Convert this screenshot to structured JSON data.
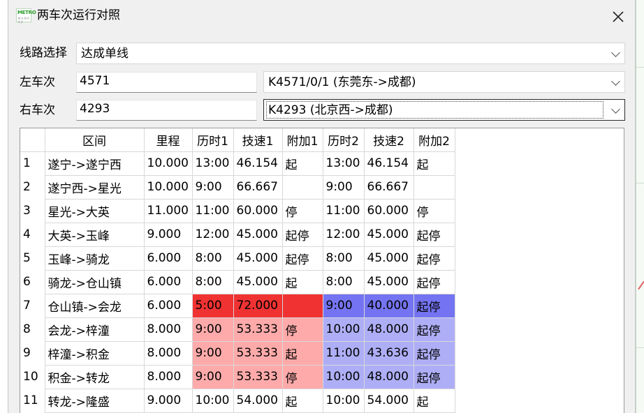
{
  "window": {
    "title": "两车次运行对照",
    "icon_text": "METRO",
    "icon_sub": "M A N A G E"
  },
  "form": {
    "line_label": "线路选择",
    "line_value": "达成单线",
    "left_label": "左车次",
    "left_value": "4571",
    "left_combo": "K4571/0/1 (东莞东->成都)",
    "right_label": "右车次",
    "right_value": "4293",
    "right_combo": "K4293 (北京西->成都)"
  },
  "table": {
    "headers": [
      "区间",
      "里程",
      "历时1",
      "技速1",
      "附加1",
      "历时2",
      "技速2",
      "附加2"
    ],
    "rows": [
      [
        "1",
        "遂宁->遂宁西",
        "10.000",
        "13:00",
        "46.154",
        "起",
        "13:00",
        "46.154",
        "起"
      ],
      [
        "2",
        "遂宁西->星光",
        "10.000",
        "9:00",
        "66.667",
        "",
        "9:00",
        "66.667",
        ""
      ],
      [
        "3",
        "星光->大英",
        "11.000",
        "11:00",
        "60.000",
        "停",
        "11:00",
        "60.000",
        "停"
      ],
      [
        "4",
        "大英->玉峰",
        "9.000",
        "12:00",
        "45.000",
        "起停",
        "12:00",
        "45.000",
        "起停"
      ],
      [
        "5",
        "玉峰->骑龙",
        "6.000",
        "8:00",
        "45.000",
        "起停",
        "8:00",
        "45.000",
        "起停"
      ],
      [
        "6",
        "骑龙->仓山镇",
        "6.000",
        "8:00",
        "45.000",
        "起",
        "8:00",
        "45.000",
        "起停"
      ],
      [
        "7",
        "仓山镇->会龙",
        "6.000",
        "5:00",
        "72.000",
        "",
        "9:00",
        "40.000",
        "起停"
      ],
      [
        "8",
        "会龙->梓潼",
        "8.000",
        "9:00",
        "53.333",
        "停",
        "10:00",
        "48.000",
        "起停"
      ],
      [
        "9",
        "梓潼->积金",
        "8.000",
        "9:00",
        "53.333",
        "起",
        "11:00",
        "43.636",
        "起停"
      ],
      [
        "10",
        "积金->转龙",
        "8.000",
        "9:00",
        "53.333",
        "停",
        "10:00",
        "48.000",
        "起停"
      ],
      [
        "11",
        "转龙->隆盛",
        "9.000",
        "10:00",
        "54.000",
        "起",
        "10:00",
        "54.000",
        "起"
      ]
    ],
    "highlights": {
      "left_strong": "#f03232",
      "left_light": "#ffaaaa",
      "right_strong": "#7474f2",
      "right_light": "#aeaef7",
      "rows": {
        "7": [
          "strong",
          "strong"
        ],
        "8": [
          "light",
          "light"
        ],
        "9": [
          "light",
          "light"
        ],
        "10": [
          "light",
          "light"
        ]
      }
    }
  }
}
